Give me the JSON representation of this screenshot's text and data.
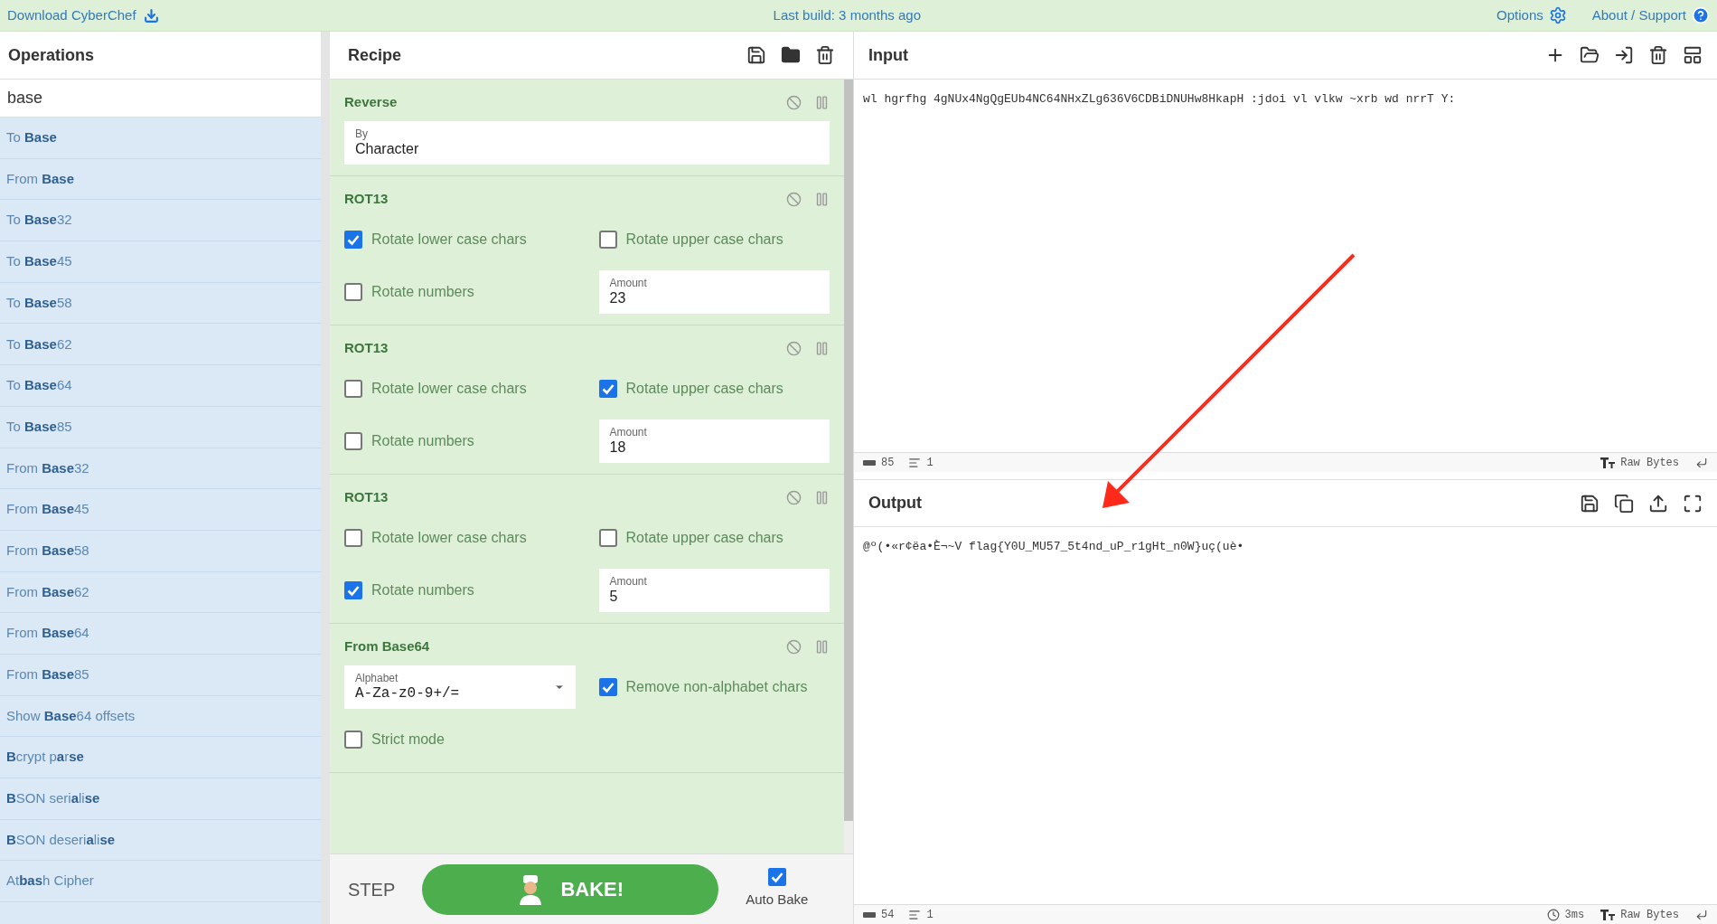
{
  "top_bar": {
    "download": "Download CyberChef",
    "build": "Last build: 3 months ago",
    "options": "Options",
    "about": "About / Support"
  },
  "operations": {
    "title": "Operations",
    "search": "base",
    "items": [
      {
        "label": "To **Base**"
      },
      {
        "label": "From **Base**"
      },
      {
        "label": "To **Base**32"
      },
      {
        "label": "To **Base**45"
      },
      {
        "label": "To **Base**58"
      },
      {
        "label": "To **Base**62"
      },
      {
        "label": "To **Base**64"
      },
      {
        "label": "To **Base**85"
      },
      {
        "label": "From **Base**32"
      },
      {
        "label": "From **Base**45"
      },
      {
        "label": "From **Base**58"
      },
      {
        "label": "From **Base**62"
      },
      {
        "label": "From **Base**64"
      },
      {
        "label": "From **Base**85"
      },
      {
        "label": "Show **Base**64 offsets"
      },
      {
        "label": "**B**crypt p**a**r**se**"
      },
      {
        "label": "**B**SON seri**a**li**se**"
      },
      {
        "label": "**B**SON deseri**a**li**se**"
      },
      {
        "label": "At**bas**h Cipher"
      }
    ]
  },
  "recipe": {
    "title": "Recipe",
    "operations": [
      {
        "title": "Reverse",
        "args": [
          {
            "kind": "select",
            "label": "By",
            "value": "Character"
          }
        ]
      },
      {
        "title": "ROT13",
        "args": [
          {
            "kind": "checkbox",
            "label": "Rotate lower case chars",
            "checked": true
          },
          {
            "kind": "checkbox",
            "label": "Rotate upper case chars",
            "checked": false
          },
          {
            "kind": "checkbox",
            "label": "Rotate numbers",
            "checked": false
          },
          {
            "kind": "number",
            "label": "Amount",
            "value": "23"
          }
        ]
      },
      {
        "title": "ROT13",
        "args": [
          {
            "kind": "checkbox",
            "label": "Rotate lower case chars",
            "checked": false
          },
          {
            "kind": "checkbox",
            "label": "Rotate upper case chars",
            "checked": true
          },
          {
            "kind": "checkbox",
            "label": "Rotate numbers",
            "checked": false
          },
          {
            "kind": "number",
            "label": "Amount",
            "value": "18"
          }
        ]
      },
      {
        "title": "ROT13",
        "args": [
          {
            "kind": "checkbox",
            "label": "Rotate lower case chars",
            "checked": false
          },
          {
            "kind": "checkbox",
            "label": "Rotate upper case chars",
            "checked": false
          },
          {
            "kind": "checkbox",
            "label": "Rotate numbers",
            "checked": true
          },
          {
            "kind": "number",
            "label": "Amount",
            "value": "5"
          }
        ]
      },
      {
        "title": "From Base64",
        "args": [
          {
            "kind": "select",
            "label": "Alphabet",
            "value": "A-Za-z0-9+/="
          },
          {
            "kind": "checkbox",
            "label": "Remove non-alphabet chars",
            "checked": true
          },
          {
            "kind": "checkbox",
            "label": "Strict mode",
            "checked": false
          }
        ]
      }
    ],
    "step": "STEP",
    "bake": "BAKE!",
    "auto_bake": {
      "label": "Auto Bake",
      "checked": true
    }
  },
  "input": {
    "title": "Input",
    "text": "wl hgrfhg 4gNUx4NgQgEUb4NC64NHxZLg636V6CDBiDNUHw8HkapH :jdoi vl vlkw  ~xrb wd nrrT Y:",
    "length": "85",
    "lines": "1",
    "format": "Raw Bytes"
  },
  "output": {
    "title": "Output",
    "text": "@º(•«r¢ëa•È¬~V flag{Y0U_MU57_5t4nd_uP_r1gHt_n0W}uç(uè•",
    "length": "54",
    "lines": "1",
    "time": "3ms",
    "format": "Raw Bytes"
  }
}
